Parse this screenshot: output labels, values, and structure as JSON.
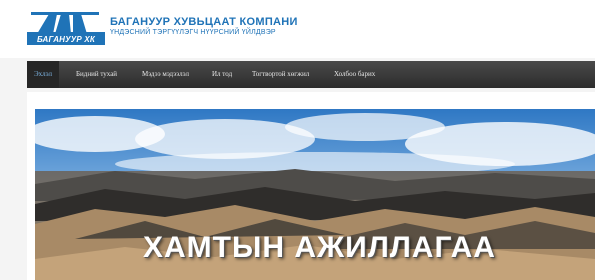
{
  "header": {
    "logo_caption": "БАГАНУУР ХК",
    "company_name": "БАГАНУУР ХУВЬЦААТ КОМПАНИ",
    "company_subtitle": "ҮНДЭСНИЙ ТЭРГҮҮЛЭГЧ НҮҮРСНИЙ ҮЙЛДВЭР"
  },
  "nav": {
    "items": [
      {
        "label": "Эхлэл",
        "active": true
      },
      {
        "label": "Бидний тухай",
        "active": false
      },
      {
        "label": "Мэдээ мэдээлэл",
        "active": false
      },
      {
        "label": "Ил тод",
        "active": false
      },
      {
        "label": "Тогтвортой хөгжил",
        "active": false
      },
      {
        "label": "Холбоо барих",
        "active": false
      }
    ]
  },
  "banner": {
    "headline": "ХАМТЫН АЖИЛЛАГАА"
  },
  "colors": {
    "brand_blue": "#1f73b7",
    "nav_bg": "#333333",
    "nav_active_text": "#7fb8e8"
  }
}
